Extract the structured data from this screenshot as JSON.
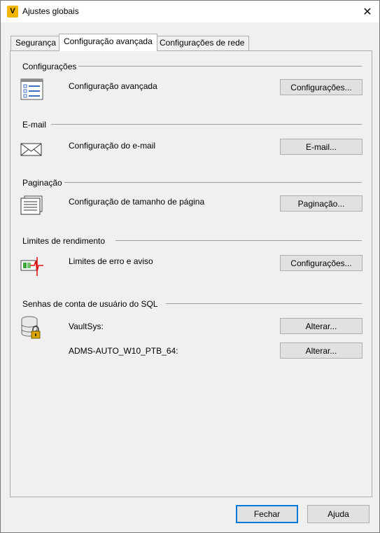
{
  "window": {
    "title": "Ajustes globais",
    "app_icon_letter": "V",
    "close_glyph": "✕"
  },
  "tabs": [
    {
      "label": "Segurança",
      "active": false
    },
    {
      "label": "Configuração avançada",
      "active": true
    },
    {
      "label": "Configurações de rede",
      "active": false
    }
  ],
  "sections": {
    "config": {
      "heading": "Configurações",
      "label": "Configuração avançada",
      "button": "Configurações...",
      "icon": "settings-list-icon"
    },
    "email": {
      "heading": "E-mail",
      "label": "Configuração do e-mail",
      "button": "E-mail...",
      "icon": "envelope-icon"
    },
    "paging": {
      "heading": "Paginação",
      "label": "Configuração de tamanho de página",
      "button": "Paginação...",
      "icon": "document-pages-icon"
    },
    "limits": {
      "heading": "Limites de rendimento",
      "label": "Limites de erro e aviso",
      "button": "Configurações...",
      "icon": "performance-meter-icon"
    },
    "sql": {
      "heading": "Senhas de conta de usuário do SQL",
      "icon": "database-lock-icon",
      "accounts": [
        {
          "label": "VaultSys:",
          "button": "Alterar..."
        },
        {
          "label": "ADMS-AUTO_W10_PTB_64:",
          "button": "Alterar..."
        }
      ]
    }
  },
  "footer": {
    "close_label": "Fechar",
    "help_label": "Ajuda"
  },
  "colors": {
    "accent": "#0078d7",
    "app_icon": "#f2b705",
    "panel_bg": "#f0f0f0",
    "button_bg": "#e1e1e1"
  }
}
